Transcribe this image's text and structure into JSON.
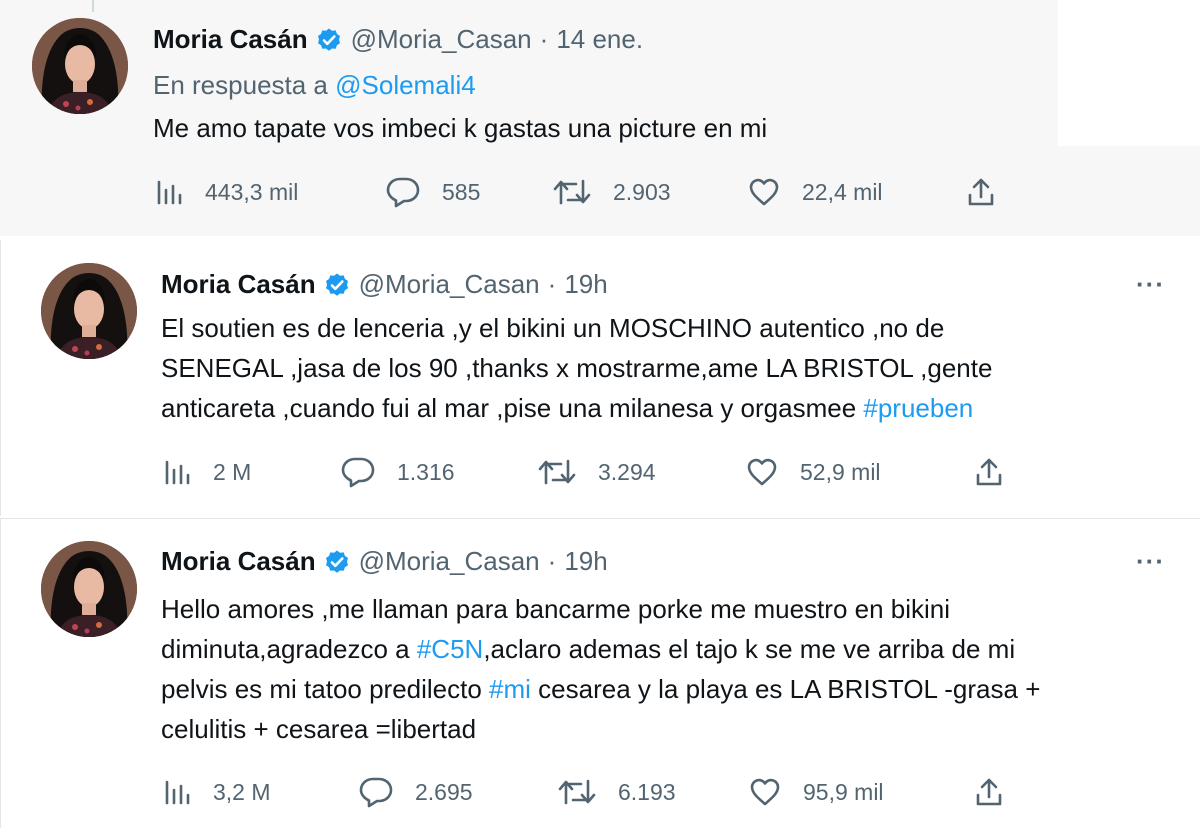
{
  "colors": {
    "link": "#1d9bf0",
    "muted": "#536471",
    "text": "#0f1419",
    "verified": "#1d9bf0"
  },
  "tweets": [
    {
      "name": "Moria Casán",
      "handle": "@Moria_Casan",
      "separator": "·",
      "time": "14 ene.",
      "reply_prefix": "En respuesta a",
      "reply_mention": "@Solemali4",
      "lines": [
        [
          {
            "text": "Me amo tapate vos imbeci  k gastas una picture en mi",
            "link": false
          }
        ]
      ],
      "stats": {
        "views": "443,3 mil",
        "replies": "585",
        "retweets": "2.903",
        "likes": "22,4 mil"
      }
    },
    {
      "name": "Moria Casán",
      "handle": "@Moria_Casan",
      "separator": "·",
      "time": "19h",
      "more": "···",
      "lines": [
        [
          {
            "text": "El soutien es de lenceria ,y el bikini un MOSCHINO autentico ,no de",
            "link": false
          }
        ],
        [
          {
            "text": "SENEGAL ,jasa de los 90 ,thanks x mostrarme,ame LA BRISTOL ,gente",
            "link": false
          }
        ],
        [
          {
            "text": "anticareta ,cuando fui al mar ,pise una milanesa y orgasmee ",
            "link": false
          },
          {
            "text": "#prueben",
            "link": true
          }
        ]
      ],
      "stats": {
        "views": "2 M",
        "replies": "1.316",
        "retweets": "3.294",
        "likes": "52,9 mil"
      }
    },
    {
      "name": "Moria Casán",
      "handle": "@Moria_Casan",
      "separator": "·",
      "time": "19h",
      "more": "···",
      "lines": [
        [
          {
            "text": "Hello amores ,me llaman para bancarme porke me muestro en bikini",
            "link": false
          }
        ],
        [
          {
            "text": "diminuta,agradezco a ",
            "link": false
          },
          {
            "text": "#C5N",
            "link": true
          },
          {
            "text": ",aclaro ademas el tajo k se me ve arriba de mi",
            "link": false
          }
        ],
        [
          {
            "text": "pelvis es mi tatoo predilecto ",
            "link": false
          },
          {
            "text": "#mi",
            "link": true
          },
          {
            "text": " cesarea y la playa es LA BRISTOL -grasa +",
            "link": false
          }
        ],
        [
          {
            "text": "celulitis + cesarea =libertad",
            "link": false
          }
        ]
      ],
      "stats": {
        "views": "3,2 M",
        "replies": "2.695",
        "retweets": "6.193",
        "likes": "95,9 mil"
      }
    }
  ],
  "icons": {
    "views": "bar-chart-icon",
    "replies": "speech-bubble-icon",
    "retweets": "retweet-arrows-icon",
    "likes": "heart-icon",
    "share": "share-upload-icon",
    "verified": "verified-badge-icon",
    "more": "more-dots-icon"
  }
}
